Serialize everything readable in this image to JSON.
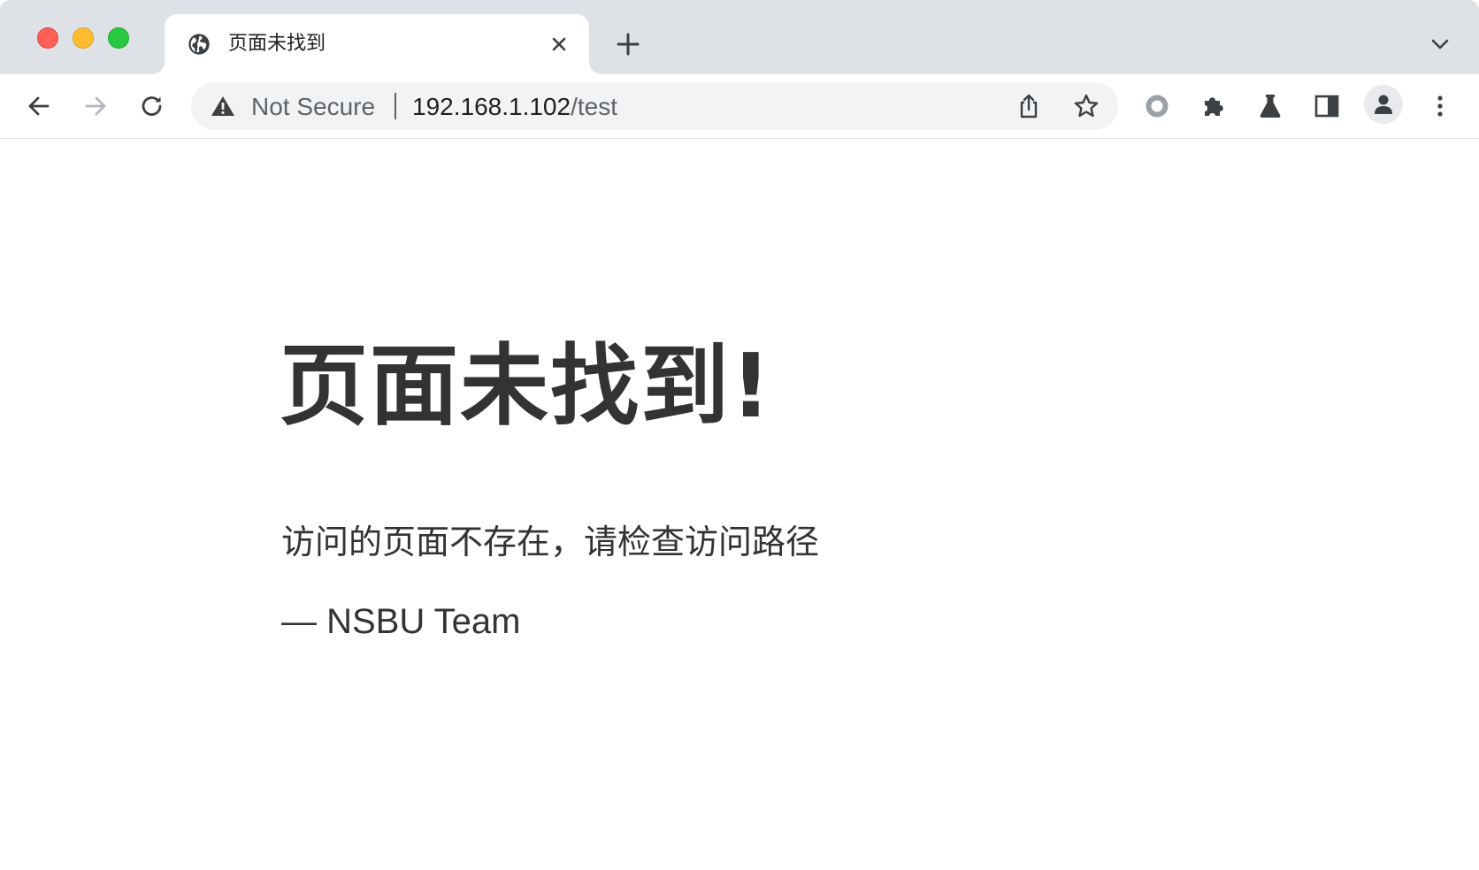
{
  "browser": {
    "tab": {
      "title": "页面未找到",
      "favicon": "globe-icon"
    },
    "new_tab_icon": "plus-icon",
    "tab_search_icon": "chevron-down-icon",
    "toolbar": {
      "back_icon": "arrow-left-icon",
      "forward_icon": "arrow-right-icon",
      "reload_icon": "reload-icon",
      "security_label": "Not Secure",
      "security_icon": "warning-triangle-icon",
      "url_host": "192.168.1.102",
      "url_path": "/test",
      "share_icon": "share-icon",
      "bookmark_icon": "star-icon",
      "extensions": [
        "record-circle-icon",
        "puzzle-icon",
        "flask-icon",
        "side-panel-icon",
        "profile-icon",
        "kebab-menu-icon"
      ]
    },
    "colors": {
      "tabstrip_bg": "#dee1e6",
      "omnibox_bg": "#f1f3f4",
      "close": "#fe5f57",
      "minimize": "#febc2e",
      "zoom": "#28c840"
    }
  },
  "page": {
    "headline": "页面未找到!",
    "message": "访问的页面不存在，请检查访问路径",
    "signature": "— NSBU Team",
    "text_color": "#333333"
  }
}
